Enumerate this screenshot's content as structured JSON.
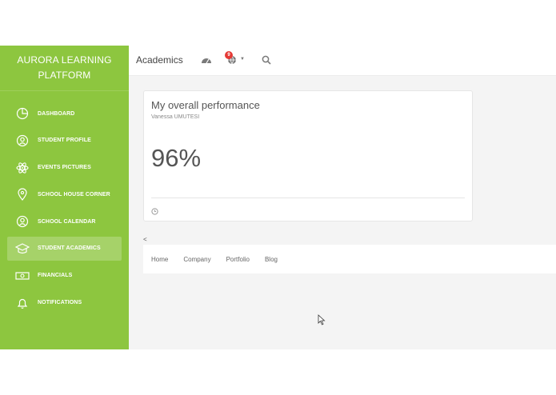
{
  "brand": {
    "line1": "AURORA LEARNING",
    "line2": "PLATFORM"
  },
  "sidebar": {
    "items": [
      {
        "label": "DASHBOARD",
        "icon": "pie-chart-icon"
      },
      {
        "label": "STUDENT PROFILE",
        "icon": "user-circle-icon"
      },
      {
        "label": "EVENTS PICTURES",
        "icon": "atom-icon"
      },
      {
        "label": "SCHOOL HOUSE CORNER",
        "icon": "map-pin-icon"
      },
      {
        "label": "SCHOOL CALENDAR",
        "icon": "user-circle-icon"
      },
      {
        "label": "STUDENT ACADEMICS",
        "icon": "graduation-cap-icon",
        "active": true
      },
      {
        "label": "FINANCIALS",
        "icon": "money-icon"
      },
      {
        "label": "NOTIFICATIONS",
        "icon": "bell-icon"
      }
    ]
  },
  "topbar": {
    "title": "Academics",
    "notification_count": "9",
    "icons": [
      "dashboard-gauge-icon",
      "globe-icon",
      "search-icon"
    ]
  },
  "card": {
    "title": "My overall performance",
    "subtitle": "Vanessa UMUTESI",
    "value": "96%"
  },
  "collapse": {
    "label": "<"
  },
  "footer_nav": {
    "links": [
      "Home",
      "Company",
      "Portfolio",
      "Blog"
    ]
  },
  "colors": {
    "sidebar": "#8dc63f",
    "badge": "#e53935",
    "background": "#f4f4f4"
  }
}
